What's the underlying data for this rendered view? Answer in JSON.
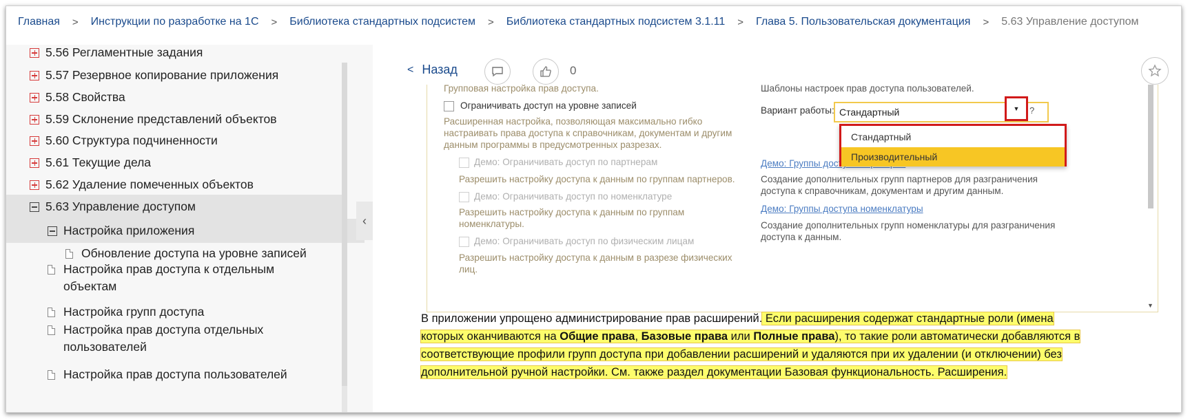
{
  "breadcrumb": {
    "items": [
      "Главная",
      "Инструкции по разработке на 1С",
      "Библиотека стандартных подсистем",
      "Библиотека стандартных подсистем 3.1.11",
      "Глава 5. Пользовательская документация"
    ],
    "current": "5.63 Управление доступом",
    "separator": ">"
  },
  "sidebar": {
    "items": [
      {
        "label": "5.56 Регламентные задания",
        "kind": "plus"
      },
      {
        "label": "5.57 Резервное копирование приложения",
        "kind": "plus"
      },
      {
        "label": "5.58 Свойства",
        "kind": "plus"
      },
      {
        "label": "5.59 Склонение представлений объектов",
        "kind": "plus"
      },
      {
        "label": "5.60 Структура подчиненности",
        "kind": "plus"
      },
      {
        "label": "5.61 Текущие дела",
        "kind": "plus"
      },
      {
        "label": "5.62 Удаление помеченных объектов",
        "kind": "plus"
      },
      {
        "label": "5.63 Управление доступом",
        "kind": "minus"
      },
      {
        "label": "Настройка приложения",
        "kind": "minus"
      },
      {
        "label": "Обновление доступа на уровне записей",
        "kind": "doc"
      },
      {
        "label": "Настройка прав доступа к отдельным объектам",
        "kind": "doc"
      },
      {
        "label": "Настройка групп доступа",
        "kind": "doc"
      },
      {
        "label": "Настройка прав доступа отдельных пользователей",
        "kind": "doc"
      },
      {
        "label": "Настройка прав доступа пользователей",
        "kind": "doc"
      }
    ]
  },
  "toolbar": {
    "back_label": "Назад",
    "like_count": "0"
  },
  "screenshot": {
    "left_heading": "Групповая настройка прав доступа.",
    "restrict_records_label": "Ограничивать доступ на уровне записей",
    "restrict_records_desc": [
      "Расширенная настройка, позволяющая максимально гибко",
      "настраивать права доступа к справочникам, документам и другим",
      "данным программы в предусмотренных разрезах."
    ],
    "demo_partners_label": "Демо: Ограничивать доступ по партнерам",
    "demo_partners_desc": "Разрешить настройку доступа к данным по группам партнеров.",
    "demo_nomenclature_label": "Демо: Ограничивать доступ по номенклатуре",
    "demo_nomenclature_desc": [
      "Разрешить настройку доступа к данным по группам",
      "номенклатуры."
    ],
    "demo_persons_label": "Демо: Ограничивать доступ по физическим лицам",
    "demo_persons_desc": [
      "Разрешить настройку доступа к данным в разрезе физических",
      "лиц."
    ],
    "right_heading": "Шаблоны настроек прав доступа пользователей.",
    "mode_label": "Вариант работы:",
    "mode_value": "Стандартный",
    "help_mark": "?",
    "dropdown_options": [
      "Стандартный",
      "Производительный"
    ],
    "link_partners": "Демо: Группы доступа партнеров",
    "link_partners_desc": [
      "Создание дополнительных групп партнеров для разграничения",
      "доступа к справочникам, документам и другим данным."
    ],
    "link_nomenclature": "Демо: Группы доступа номенклатуры",
    "link_nomenclature_desc": [
      "Создание дополнительных групп номенклатуры для разграничения",
      "доступа к данным."
    ]
  },
  "article": {
    "plain_start": "В приложении упрощено администрирование прав расширений.",
    "hl_1": " Если расширения содержат стандартные роли (имена которых оканчиваются на ",
    "bold_1": "Общие права",
    "sep_1": ", ",
    "bold_2": "Базовые права",
    "sep_2": " или ",
    "bold_3": "Полные права",
    "hl_2": "), то такие роли автоматически добавляются в соответствующие профили групп доступа при добавлении расширений и удаляются при их удалении (и отключении) без дополнительной ручной настройки. См. также раздел документации Базовая функциональность. Расширения."
  },
  "colors": {
    "link": "#1a4a8c",
    "highlight": "#fdfd6c",
    "annotation_red": "#d11a1a",
    "dropdown_selected": "#f7c624",
    "tree_expander": "#d63a3a"
  }
}
